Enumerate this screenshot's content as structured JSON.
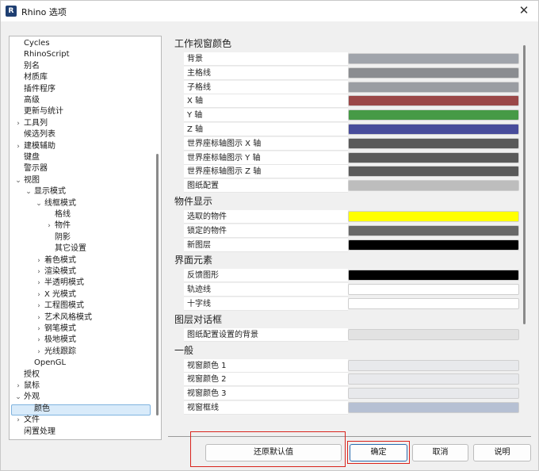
{
  "window": {
    "title": "Rhino 选项",
    "app_icon_letter": "R",
    "close_glyph": "✕"
  },
  "tree": {
    "items": [
      {
        "label": "Cycles",
        "level": 0,
        "caret": ""
      },
      {
        "label": "RhinoScript",
        "level": 0,
        "caret": ""
      },
      {
        "label": "别名",
        "level": 0,
        "caret": ""
      },
      {
        "label": "材质库",
        "level": 0,
        "caret": ""
      },
      {
        "label": "插件程序",
        "level": 0,
        "caret": ""
      },
      {
        "label": "高级",
        "level": 0,
        "caret": ""
      },
      {
        "label": "更新与统计",
        "level": 0,
        "caret": ""
      },
      {
        "label": "工具列",
        "level": 0,
        "caret": "›"
      },
      {
        "label": "候选列表",
        "level": 0,
        "caret": ""
      },
      {
        "label": "建模辅助",
        "level": 0,
        "caret": "›"
      },
      {
        "label": "键盘",
        "level": 0,
        "caret": ""
      },
      {
        "label": "警示器",
        "level": 0,
        "caret": ""
      },
      {
        "label": "视图",
        "level": 0,
        "caret": "⌄"
      },
      {
        "label": "显示模式",
        "level": 1,
        "caret": "⌄"
      },
      {
        "label": "线框模式",
        "level": 2,
        "caret": "⌄"
      },
      {
        "label": "格线",
        "level": 3,
        "caret": ""
      },
      {
        "label": "物件",
        "level": 3,
        "caret": "›"
      },
      {
        "label": "阴影",
        "level": 3,
        "caret": ""
      },
      {
        "label": "其它设置",
        "level": 3,
        "caret": ""
      },
      {
        "label": "着色模式",
        "level": 2,
        "caret": "›"
      },
      {
        "label": "渲染模式",
        "level": 2,
        "caret": "›"
      },
      {
        "label": "半透明模式",
        "level": 2,
        "caret": "›"
      },
      {
        "label": "X 光模式",
        "level": 2,
        "caret": "›"
      },
      {
        "label": "工程图模式",
        "level": 2,
        "caret": "›"
      },
      {
        "label": "艺术风格模式",
        "level": 2,
        "caret": "›"
      },
      {
        "label": "钢笔模式",
        "level": 2,
        "caret": "›"
      },
      {
        "label": "极地模式",
        "level": 2,
        "caret": "›"
      },
      {
        "label": "光线跟踪",
        "level": 2,
        "caret": "›"
      },
      {
        "label": "OpenGL",
        "level": 1,
        "caret": ""
      },
      {
        "label": "授权",
        "level": 0,
        "caret": ""
      },
      {
        "label": "鼠标",
        "level": 0,
        "caret": "›"
      },
      {
        "label": "外观",
        "level": 0,
        "caret": "⌄"
      },
      {
        "label": "颜色",
        "level": 1,
        "caret": ""
      },
      {
        "label": "文件",
        "level": 0,
        "caret": "›"
      },
      {
        "label": "闲置处理",
        "level": 0,
        "caret": ""
      }
    ]
  },
  "sections": [
    {
      "title": "工作视窗颜色",
      "rows": [
        {
          "label": "背景",
          "color": "#a0a4ab"
        },
        {
          "label": "主格线",
          "color": "#8a8c90"
        },
        {
          "label": "子格线",
          "color": "#9a9da2"
        },
        {
          "label": "X 轴",
          "color": "#9b4848"
        },
        {
          "label": "Y 轴",
          "color": "#469a46"
        },
        {
          "label": "Z 轴",
          "color": "#484c9b"
        },
        {
          "label": "世界座标轴图示 X 轴",
          "color": "#5a5a5a"
        },
        {
          "label": "世界座标轴图示 Y 轴",
          "color": "#5a5a5a"
        },
        {
          "label": "世界座标轴图示 Z 轴",
          "color": "#5a5a5a"
        },
        {
          "label": "图纸配置",
          "color": "#bdbdbd"
        }
      ]
    },
    {
      "title": "物件显示",
      "rows": [
        {
          "label": "选取的物件",
          "color": "#ffff00"
        },
        {
          "label": "锁定的物件",
          "color": "#686868"
        },
        {
          "label": "新图层",
          "color": "#000000"
        }
      ]
    },
    {
      "title": "界面元素",
      "rows": [
        {
          "label": "反馈图形",
          "color": "#000000"
        },
        {
          "label": "轨迹线",
          "color": "#ffffff"
        },
        {
          "label": "十字线",
          "color": "#ffffff"
        }
      ]
    },
    {
      "title": "图层对话框",
      "rows": [
        {
          "label": "图纸配置设置的背景",
          "color": "#e2e2e2"
        }
      ]
    },
    {
      "title": "一般",
      "rows": [
        {
          "label": "视窗颜色 1",
          "color": "#e8e9ec"
        },
        {
          "label": "视窗颜色 2",
          "color": "#e8e9ec"
        },
        {
          "label": "视窗颜色 3",
          "color": "#e8e9ec"
        },
        {
          "label": "视窗框线",
          "color": "#b6c0d3"
        }
      ]
    }
  ],
  "buttons": {
    "restore_defaults": "还原默认值",
    "ok": "确定",
    "cancel": "取消",
    "help": "说明"
  },
  "colors": {
    "highlight_box": "#d9231c",
    "selection_bg": "#d9ebfa"
  }
}
